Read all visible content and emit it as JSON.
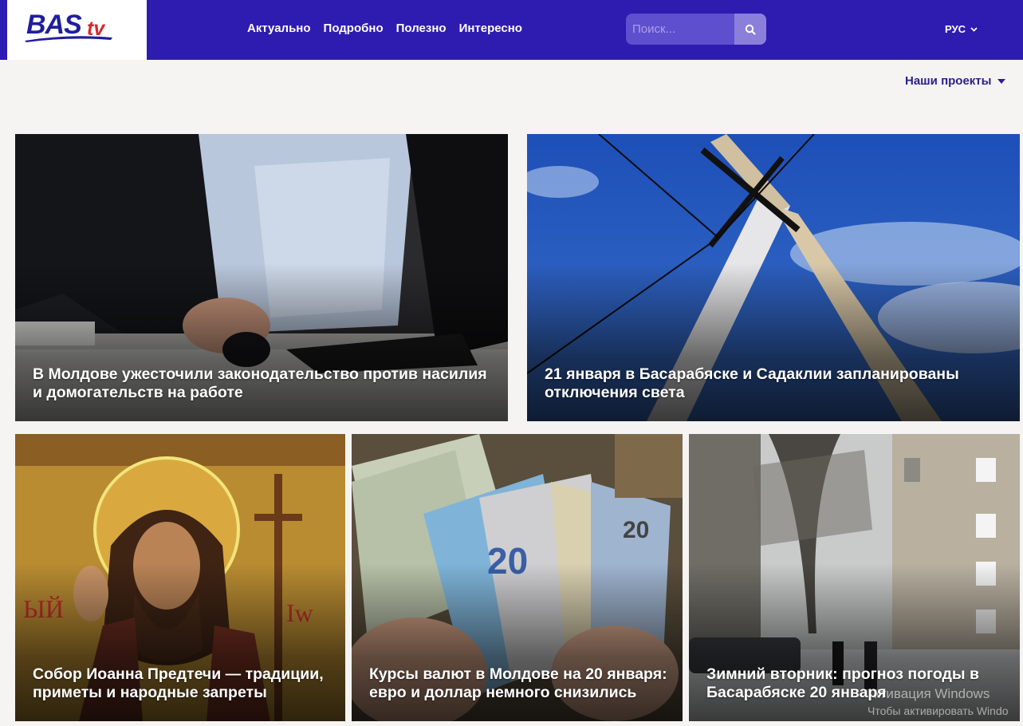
{
  "header": {
    "logo": {
      "main": "BAS",
      "suffix": "tv"
    },
    "nav": [
      "Актуально",
      "Подробно",
      "Полезно",
      "Интересно"
    ],
    "search": {
      "placeholder": "Поиск...",
      "icon": "search-icon"
    },
    "language": "РУС"
  },
  "projects_menu": "Наши проекты",
  "articles": [
    {
      "title": "В Молдове ужесточили законодательство против насилия и домогательств на работе"
    },
    {
      "title": "21 января в Басарабяске и Садаклии запланированы отключения света"
    },
    {
      "title": "Собор Иоанна Предтечи — традиции, приметы и народные запреты"
    },
    {
      "title": "Курсы валют в Молдове на 20 января: евро и доллар немного снизились"
    },
    {
      "title": "Зимний вторник: прогноз погоды в Басарабяске 20 января"
    }
  ],
  "watermark": {
    "line1": "ктивация Windows",
    "line2": "Чтобы активировать Windo"
  },
  "colors": {
    "header_bg": "#2e1cb0",
    "accent": "#2a1f8f",
    "logo_red": "#d12a2a"
  }
}
